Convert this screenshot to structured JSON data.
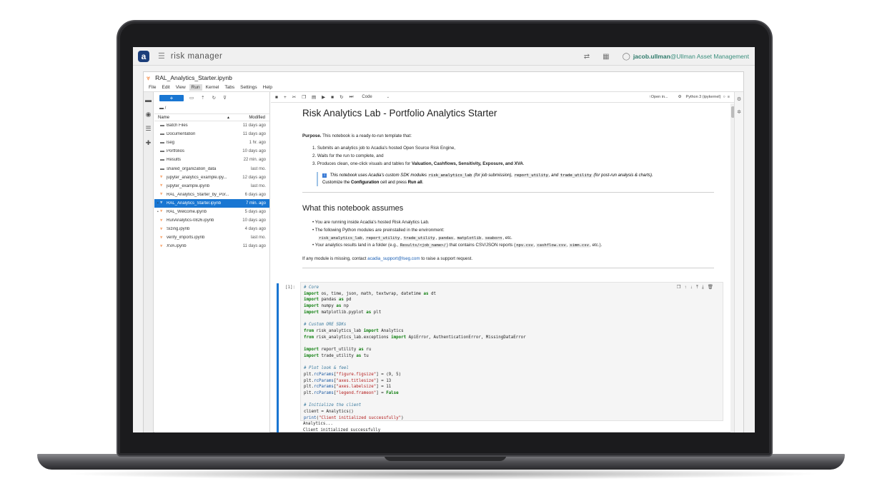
{
  "app": {
    "menu_icon": "menu-icon",
    "logo_letter": "a",
    "title": "risk manager",
    "user": "jacob.ullman",
    "org": "@Ullman Asset Management"
  },
  "notebook": {
    "filename": "RAL_Analytics_Starter.ipynb",
    "menu": [
      "File",
      "Edit",
      "View",
      "Run",
      "Kernel",
      "Tabs",
      "Settings",
      "Help"
    ],
    "cell_type": "Code",
    "open_in": "Open in...",
    "kernel": "Python 3 (ipykernel)"
  },
  "filebrowser": {
    "new_label": "+",
    "path": "/",
    "col_name": "Name",
    "col_modified": "Modified",
    "files": [
      {
        "name": "Batch Files",
        "modified": "11 days ago",
        "type": "folder"
      },
      {
        "name": "Documentation",
        "modified": "11 days ago",
        "type": "folder"
      },
      {
        "name": "lseg",
        "modified": "1 hr. ago",
        "type": "folder"
      },
      {
        "name": "Portfolios",
        "modified": "10 days ago",
        "type": "folder"
      },
      {
        "name": "Results",
        "modified": "22 min. ago",
        "type": "folder"
      },
      {
        "name": "shared_organization_data",
        "modified": "last mo.",
        "type": "folder"
      },
      {
        "name": "jupyter_analytics_example.ipy...",
        "modified": "12 days ago",
        "type": "notebook"
      },
      {
        "name": "jupyter_example.ipynb",
        "modified": "last mo.",
        "type": "notebook"
      },
      {
        "name": "RAL_Analytics_Starter_by_Por...",
        "modified": "6 days ago",
        "type": "notebook"
      },
      {
        "name": "RAL_Analytics_Starter.ipynb",
        "modified": "7 min. ago",
        "type": "notebook",
        "selected": true
      },
      {
        "name": "RAL_Welcome.ipynb",
        "modified": "5 days ago",
        "type": "notebook"
      },
      {
        "name": "RunAnalytics-0826.ipynb",
        "modified": "10 days ago",
        "type": "notebook"
      },
      {
        "name": "Sizing.ipynb",
        "modified": "4 days ago",
        "type": "notebook"
      },
      {
        "name": "verify_imports.ipynb",
        "modified": "last mo.",
        "type": "notebook"
      },
      {
        "name": "XVA.ipynb",
        "modified": "11 days ago",
        "type": "notebook"
      }
    ]
  },
  "content": {
    "h1": "Risk Analytics Lab - Portfolio Analytics Starter",
    "purpose_label": "Purpose.",
    "purpose_text": " This notebook is a ready-to-run template that:",
    "steps": [
      "Submits an analytics job to Acadia's hosted Open Source Risk Engine,",
      "Waits for the run to complete, and",
      "Produces clean, one-click visuals and tables for "
    ],
    "steps_bold": "Valuation, Cashflows, Sensitivity, Exposure, and XVA",
    "note_text": "This notebook uses Acadia's custom SDK modules",
    "note_mod1": "risk_analytics_lab",
    "note_mid1": "(for job submission),",
    "note_mod2": "report_utility",
    "note_mid2": ", and",
    "note_mod3": "trade_utility",
    "note_end": "(for post-run analysis & charts).",
    "note_line2a": "Customize the ",
    "note_config": "Configuration",
    "note_line2b": " cell and press ",
    "note_runall": "Run all",
    "h2": "What this notebook assumes",
    "assume1": "You are running inside Acadia's hosted Risk Analytics Lab.",
    "assume2": "The following Python modules are preinstalled in the environment:",
    "modules": [
      "risk_analytics_lab",
      "report_utility",
      "trade_utility",
      "pandas",
      "matplotlib",
      "seaborn"
    ],
    "modules_end": ", etc.",
    "assume3a": "Your analytics results land in a folder (e.g.,",
    "assume3_path": "Results/<job_name>/",
    "assume3b": ") that contains CSV/JSON reports (",
    "reports": [
      "npv.csv",
      "cashflow.csv",
      "simm.csv"
    ],
    "reports_end": ", etc.).",
    "missing_a": "If any module is missing, contact ",
    "support_email": "acadia_support@lseg.com",
    "missing_b": " to raise a support request.",
    "prompt": "[1]:",
    "output_lines": [
      "Analytics...",
      "Client initialized successfully"
    ]
  }
}
